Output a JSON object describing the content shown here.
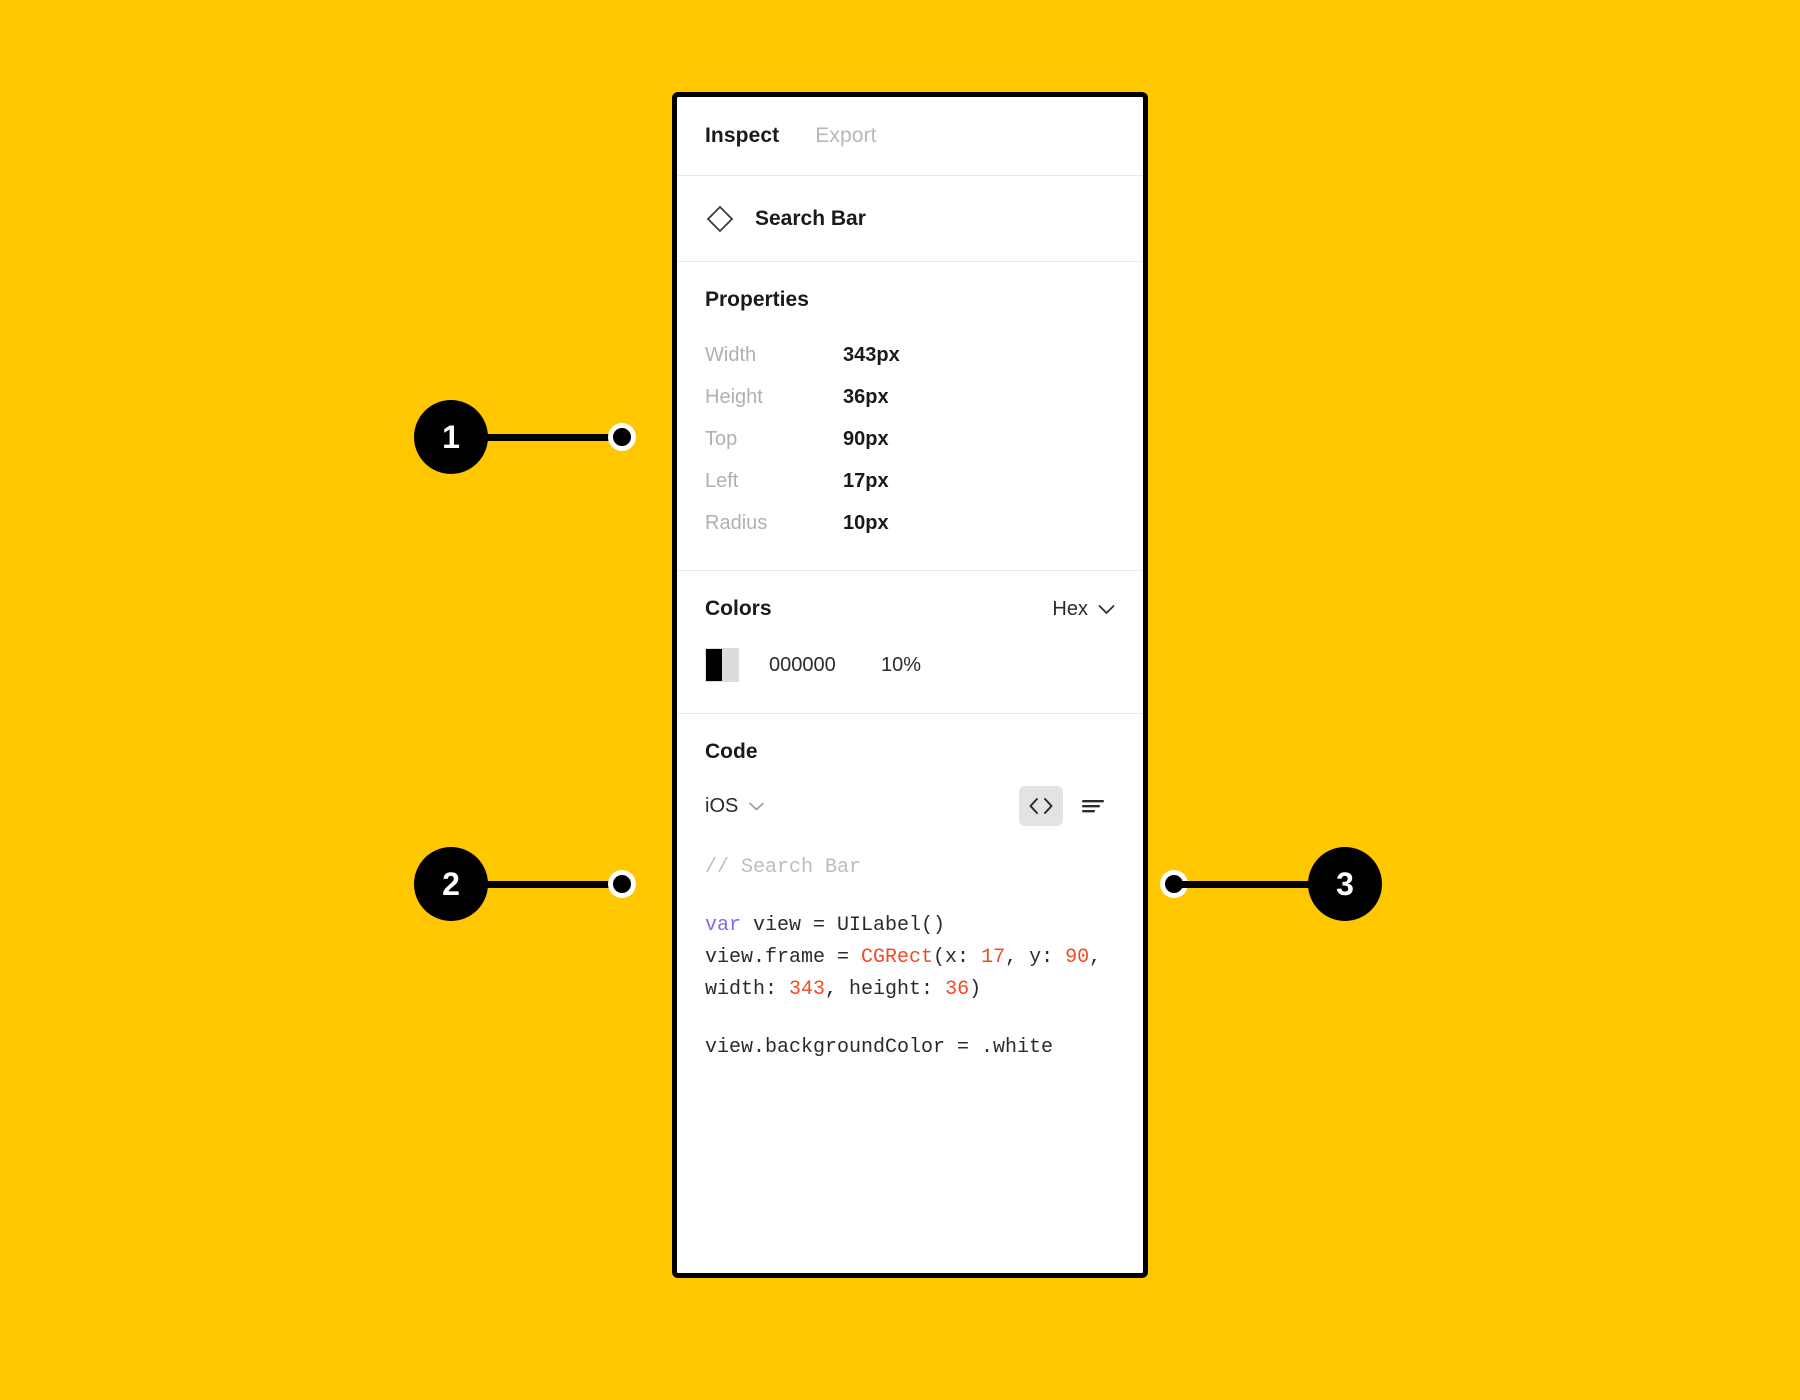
{
  "canvas": {
    "background_color": "#FFC700"
  },
  "panel": {
    "border_color": "#000000",
    "tabs": [
      {
        "label": "Inspect",
        "active": true
      },
      {
        "label": "Export",
        "active": false
      }
    ],
    "layer": {
      "icon": "component-diamond-icon",
      "name": "Search Bar"
    },
    "properties": {
      "title": "Properties",
      "rows": [
        {
          "label": "Width",
          "value": "343px"
        },
        {
          "label": "Height",
          "value": "36px"
        },
        {
          "label": "Top",
          "value": "90px"
        },
        {
          "label": "Left",
          "value": "17px"
        },
        {
          "label": "Radius",
          "value": "10px"
        }
      ]
    },
    "colors": {
      "title": "Colors",
      "format": "Hex",
      "format_chevron": "chevron-down-icon",
      "swatch": {
        "solid_color": "#000000",
        "alpha_color": "#dcdcdc"
      },
      "hex": "000000",
      "opacity": "10%"
    },
    "code": {
      "title": "Code",
      "platform": "iOS",
      "platform_chevron": "chevron-down-icon",
      "view_toggles": [
        {
          "icon": "code-brackets-icon",
          "selected": true
        },
        {
          "icon": "text-lines-icon",
          "selected": false
        }
      ],
      "comment": "// Search Bar",
      "lines": {
        "keyword_var": "var",
        "after_var": " view = UILabel()",
        "frame_prefix": "view.frame = ",
        "type_cgrect": "CGRect",
        "frame_x_label": "(x: ",
        "frame_x": "17",
        "frame_y_label": ", y: ",
        "frame_y": "90",
        "frame_w_label": ", width: ",
        "frame_w": "343",
        "frame_h_label": ", height: ",
        "frame_h": "36",
        "frame_close": ")",
        "background": "view.backgroundColor = .white"
      },
      "colors": {
        "comment": "#bdbdbd",
        "keyword": "#7c6cf0",
        "type": "#f04a28",
        "number": "#f04a28",
        "text": "#2b2b2b"
      }
    }
  },
  "callouts": [
    {
      "number": "1",
      "side": "left"
    },
    {
      "number": "2",
      "side": "left"
    },
    {
      "number": "3",
      "side": "right"
    }
  ]
}
